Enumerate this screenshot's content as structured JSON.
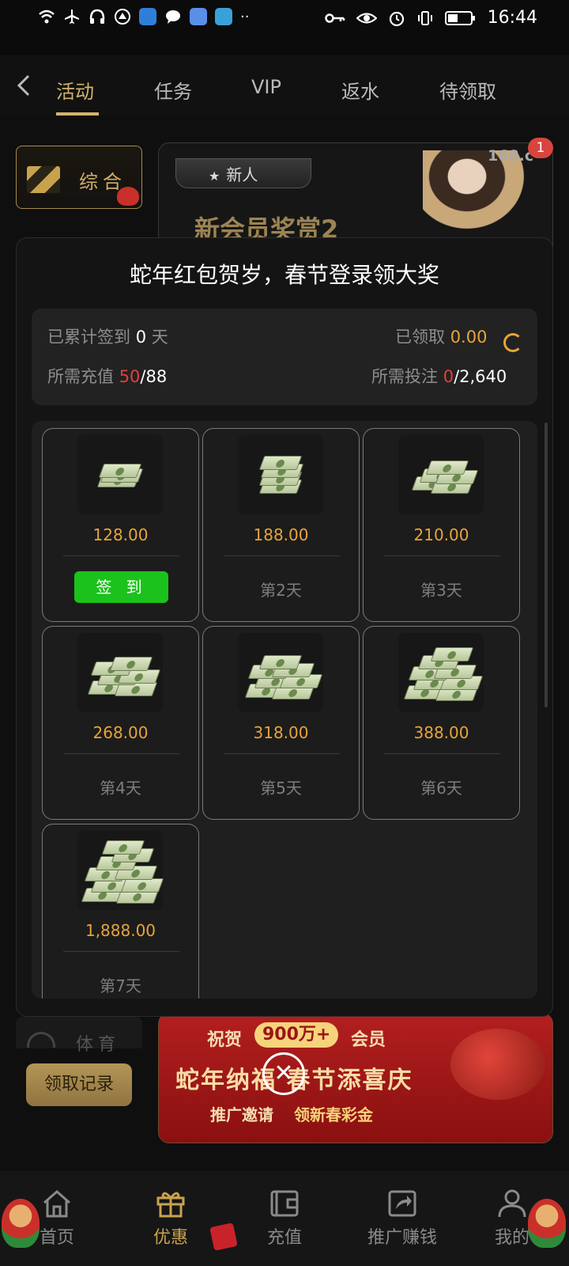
{
  "status_bar": {
    "time": "16:44",
    "left_icons": [
      "wifi-icon",
      "airplane-icon",
      "headphones-icon",
      "sailboat-icon",
      "app-icon",
      "chat-icon",
      "blue-app-icon",
      "book-app-icon",
      "more-dots-icon"
    ],
    "right_icons": [
      "key-icon",
      "eye-icon",
      "alarm-icon",
      "vibrate-icon",
      "battery-icon"
    ]
  },
  "top_nav": {
    "tabs": [
      {
        "label": "活动",
        "active": true
      },
      {
        "label": "任务"
      },
      {
        "label": "VIP"
      },
      {
        "label": "返水"
      },
      {
        "label": "待领取"
      }
    ]
  },
  "sidebar": {
    "category_label": "综合",
    "sports_label": "体育",
    "record_button": "领取记录"
  },
  "banner_top": {
    "badge": "新人",
    "title": "新会员奖赏2",
    "site": "168.c",
    "notification_count": "1"
  },
  "banner_bottom": {
    "line1_prefix": "祝贺",
    "highlight": "900万+",
    "line1_suffix": "会员",
    "line2": "蛇年纳福 春节添喜庆",
    "line3_prefix": "推广邀请",
    "line3_suffix": "领新春彩金"
  },
  "modal": {
    "title": "蛇年红包贺岁，春节登录领大奖",
    "summary": {
      "signed_label": "已累计签到",
      "signed_value": "0",
      "signed_unit": "天",
      "claimed_label": "已领取",
      "claimed_value": "0.00",
      "deposit_label": "所需充值",
      "deposit_current": "50",
      "deposit_total": "/88",
      "bet_label": "所需投注",
      "bet_current": "0",
      "bet_total": "/2,640"
    },
    "cards": [
      {
        "amount": "128.00",
        "day": "签 到",
        "is_button": true
      },
      {
        "amount": "188.00",
        "day": "第2天"
      },
      {
        "amount": "210.00",
        "day": "第3天"
      },
      {
        "amount": "268.00",
        "day": "第4天"
      },
      {
        "amount": "318.00",
        "day": "第5天"
      },
      {
        "amount": "388.00",
        "day": "第6天"
      },
      {
        "amount": "1,888.00",
        "day": "第7天"
      }
    ]
  },
  "bottom_nav": {
    "items": [
      {
        "label": "首页",
        "icon": "home-icon"
      },
      {
        "label": "优惠",
        "icon": "gift-icon",
        "active": true
      },
      {
        "label": "充值",
        "icon": "wallet-icon"
      },
      {
        "label": "推广赚钱",
        "icon": "share-icon"
      },
      {
        "label": "我的",
        "icon": "user-icon"
      }
    ]
  },
  "colors": {
    "gold": "#d4b36b",
    "amount": "#e7a43b",
    "red": "#e0403a",
    "green": "#1bc21b"
  }
}
